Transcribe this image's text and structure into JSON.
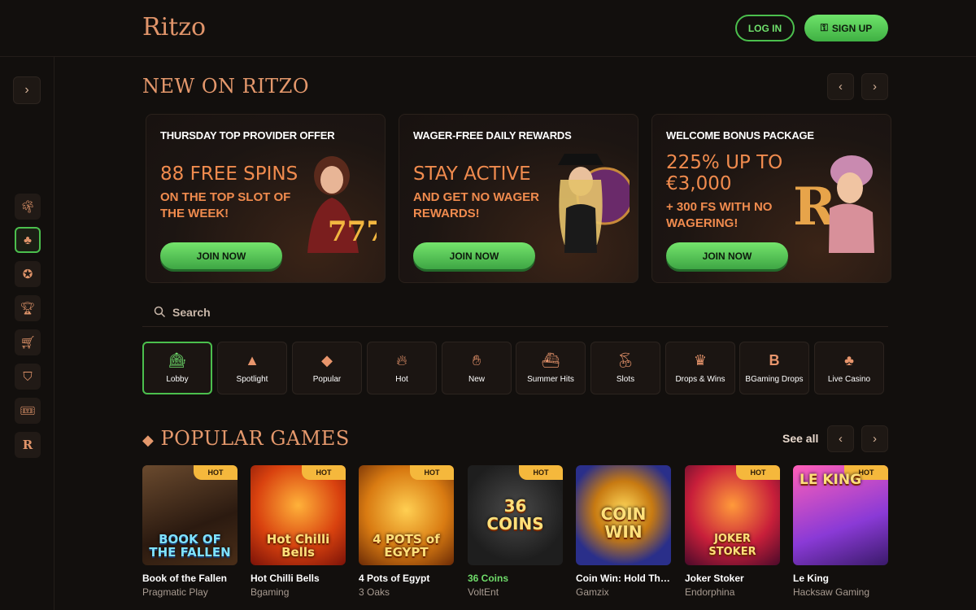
{
  "header": {
    "logo": "Ritzo",
    "login_label": "LOG IN",
    "signup_label": "SIGN UP"
  },
  "sidebar": {
    "toggle_icon": "chevron-right-icon",
    "items": [
      {
        "icon": "palm-tree-icon"
      },
      {
        "icon": "club-icon",
        "active": true
      },
      {
        "icon": "promo-badge-icon"
      },
      {
        "icon": "trophy-icon"
      },
      {
        "icon": "cart-icon"
      },
      {
        "icon": "shield-icon"
      },
      {
        "icon": "ticket-icon"
      },
      {
        "icon": "ritzo-r-icon"
      }
    ]
  },
  "new_section": {
    "title": "NEW ON RITZO"
  },
  "promos": [
    {
      "tag": "THURSDAY TOP PROVIDER OFFER",
      "headline": "88 FREE SPINS",
      "sub": "ON THE TOP SLOT OF THE WEEK!",
      "cta": "JOIN NOW"
    },
    {
      "tag": "WAGER-FREE DAILY REWARDS",
      "headline": "STAY ACTIVE",
      "sub": "AND GET NO WAGER REWARDS!",
      "cta": "JOIN NOW"
    },
    {
      "tag": "WELCOME BONUS PACKAGE",
      "headline": "225% UP TO €3,000",
      "sub": "+ 300 FS WITH NO WAGERING!",
      "cta": "JOIN NOW"
    }
  ],
  "search": {
    "placeholder": "Search"
  },
  "categories": [
    {
      "label": "Lobby",
      "icon": "slot-machine-icon",
      "active": true
    },
    {
      "label": "Spotlight",
      "icon": "spotlight-icon"
    },
    {
      "label": "Popular",
      "icon": "diamond-icon"
    },
    {
      "label": "Hot",
      "icon": "flame-icon"
    },
    {
      "label": "New",
      "icon": "new-hand-icon"
    },
    {
      "label": "Summer Hits",
      "icon": "ship-icon"
    },
    {
      "label": "Slots",
      "icon": "cherries-icon"
    },
    {
      "label": "Drops & Wins",
      "icon": "crown-icon"
    },
    {
      "label": "BGaming Drops",
      "icon": "b-logo-icon"
    },
    {
      "label": "Live Casino",
      "icon": "club-icon"
    }
  ],
  "popular": {
    "title": "POPULAR GAMES",
    "see_all": "See all"
  },
  "games": [
    {
      "name": "Book of the Fallen",
      "provider": "Pragmatic Play",
      "badge": "HOT",
      "art_title": "BOOK OF THE FALLEN"
    },
    {
      "name": "Hot Chilli Bells",
      "provider": "Bgaming",
      "badge": "HOT",
      "art_title": "Hot Chilli Bells"
    },
    {
      "name": "4 Pots of Egypt",
      "provider": "3 Oaks",
      "badge": "HOT",
      "art_title": "4 POTS of EGYPT"
    },
    {
      "name": "36 Coins",
      "provider": "VoltEnt",
      "badge": "HOT",
      "art_title": "36 COINS"
    },
    {
      "name": "Coin Win: Hold The ...",
      "provider": "Gamzix",
      "badge": "",
      "art_title": "COIN WIN"
    },
    {
      "name": "Joker Stoker",
      "provider": "Endorphina",
      "badge": "HOT",
      "art_title": "JOKER STOKER"
    },
    {
      "name": "Le King",
      "provider": "Hacksaw Gaming",
      "badge": "HOT",
      "art_title": "LE KING"
    }
  ]
}
